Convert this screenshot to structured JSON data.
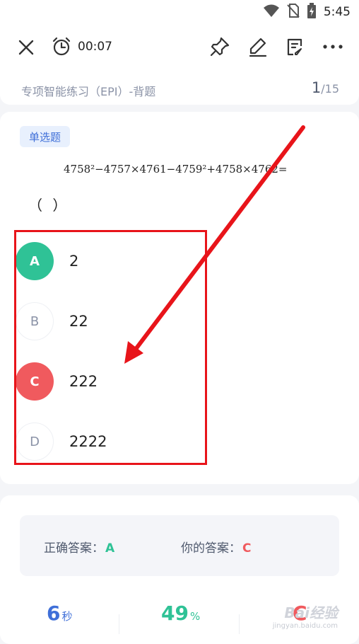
{
  "status_bar": {
    "time": "5:45",
    "icons": [
      "wifi-icon",
      "no-sim-icon",
      "battery-charging-icon"
    ]
  },
  "header": {
    "timer": "00:07",
    "icons": [
      "close-icon",
      "alarm-clock-icon",
      "pin-icon",
      "pencil-icon",
      "note-edit-icon",
      "more-icon"
    ]
  },
  "subheader": {
    "title": "专项智能练习（EPI）-背题",
    "progress_current": "1",
    "progress_total": "/15"
  },
  "question": {
    "type_tag": "单选题",
    "text": "4758²−4757×4761−4759²+4758×4762=",
    "blank": "（ ）",
    "options": [
      {
        "letter": "A",
        "text": "2",
        "state": "correct"
      },
      {
        "letter": "B",
        "text": "22",
        "state": "none"
      },
      {
        "letter": "C",
        "text": "222",
        "state": "wrong"
      },
      {
        "letter": "D",
        "text": "2222",
        "state": "none"
      }
    ]
  },
  "result": {
    "correct_label": "正确答案：",
    "correct_value": "A",
    "yours_label": "你的答案：",
    "yours_value": "C",
    "stats": [
      {
        "value": "6",
        "unit": "秒",
        "color": "#3f6fd8"
      },
      {
        "value": "49",
        "unit": "%",
        "color": "#2fc296"
      },
      {
        "value": "C",
        "unit": "",
        "color": "#f05a5e"
      }
    ]
  },
  "watermark": {
    "logo": "Bai经验",
    "url": "jingyan.baidu.com"
  },
  "colors": {
    "correct": "#2fc296",
    "wrong": "#f05a5e",
    "accent": "#3f6fd8",
    "annotation": "#e8141a"
  }
}
